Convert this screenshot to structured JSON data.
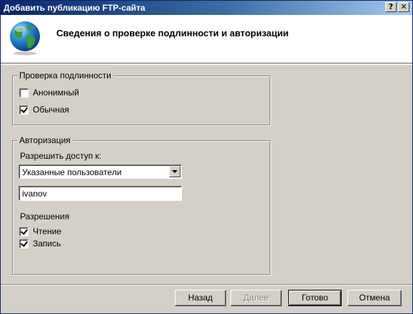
{
  "window": {
    "title": "Добавить публикацию FTP-сайта",
    "help_glyph": "?",
    "close_glyph": "✕"
  },
  "header": {
    "title": "Сведения о проверке подлинности и авторизации",
    "icon": "globe-icon"
  },
  "authentication": {
    "legend": "Проверка подлинности",
    "options": [
      {
        "label": "Анонимный",
        "checked": false
      },
      {
        "label": "Обычная",
        "checked": true
      }
    ]
  },
  "authorization": {
    "legend": "Авторизация",
    "access_label": "Разрешить доступ к:",
    "access_value": "Указанные пользователи",
    "users_value": "ivanov",
    "permissions_label": "Разрешения",
    "permissions": [
      {
        "label": "Чтение",
        "checked": true
      },
      {
        "label": "Запись",
        "checked": true
      }
    ]
  },
  "buttons": {
    "back": "Назад",
    "next": "Далее",
    "finish": "Готово",
    "cancel": "Отмена"
  }
}
